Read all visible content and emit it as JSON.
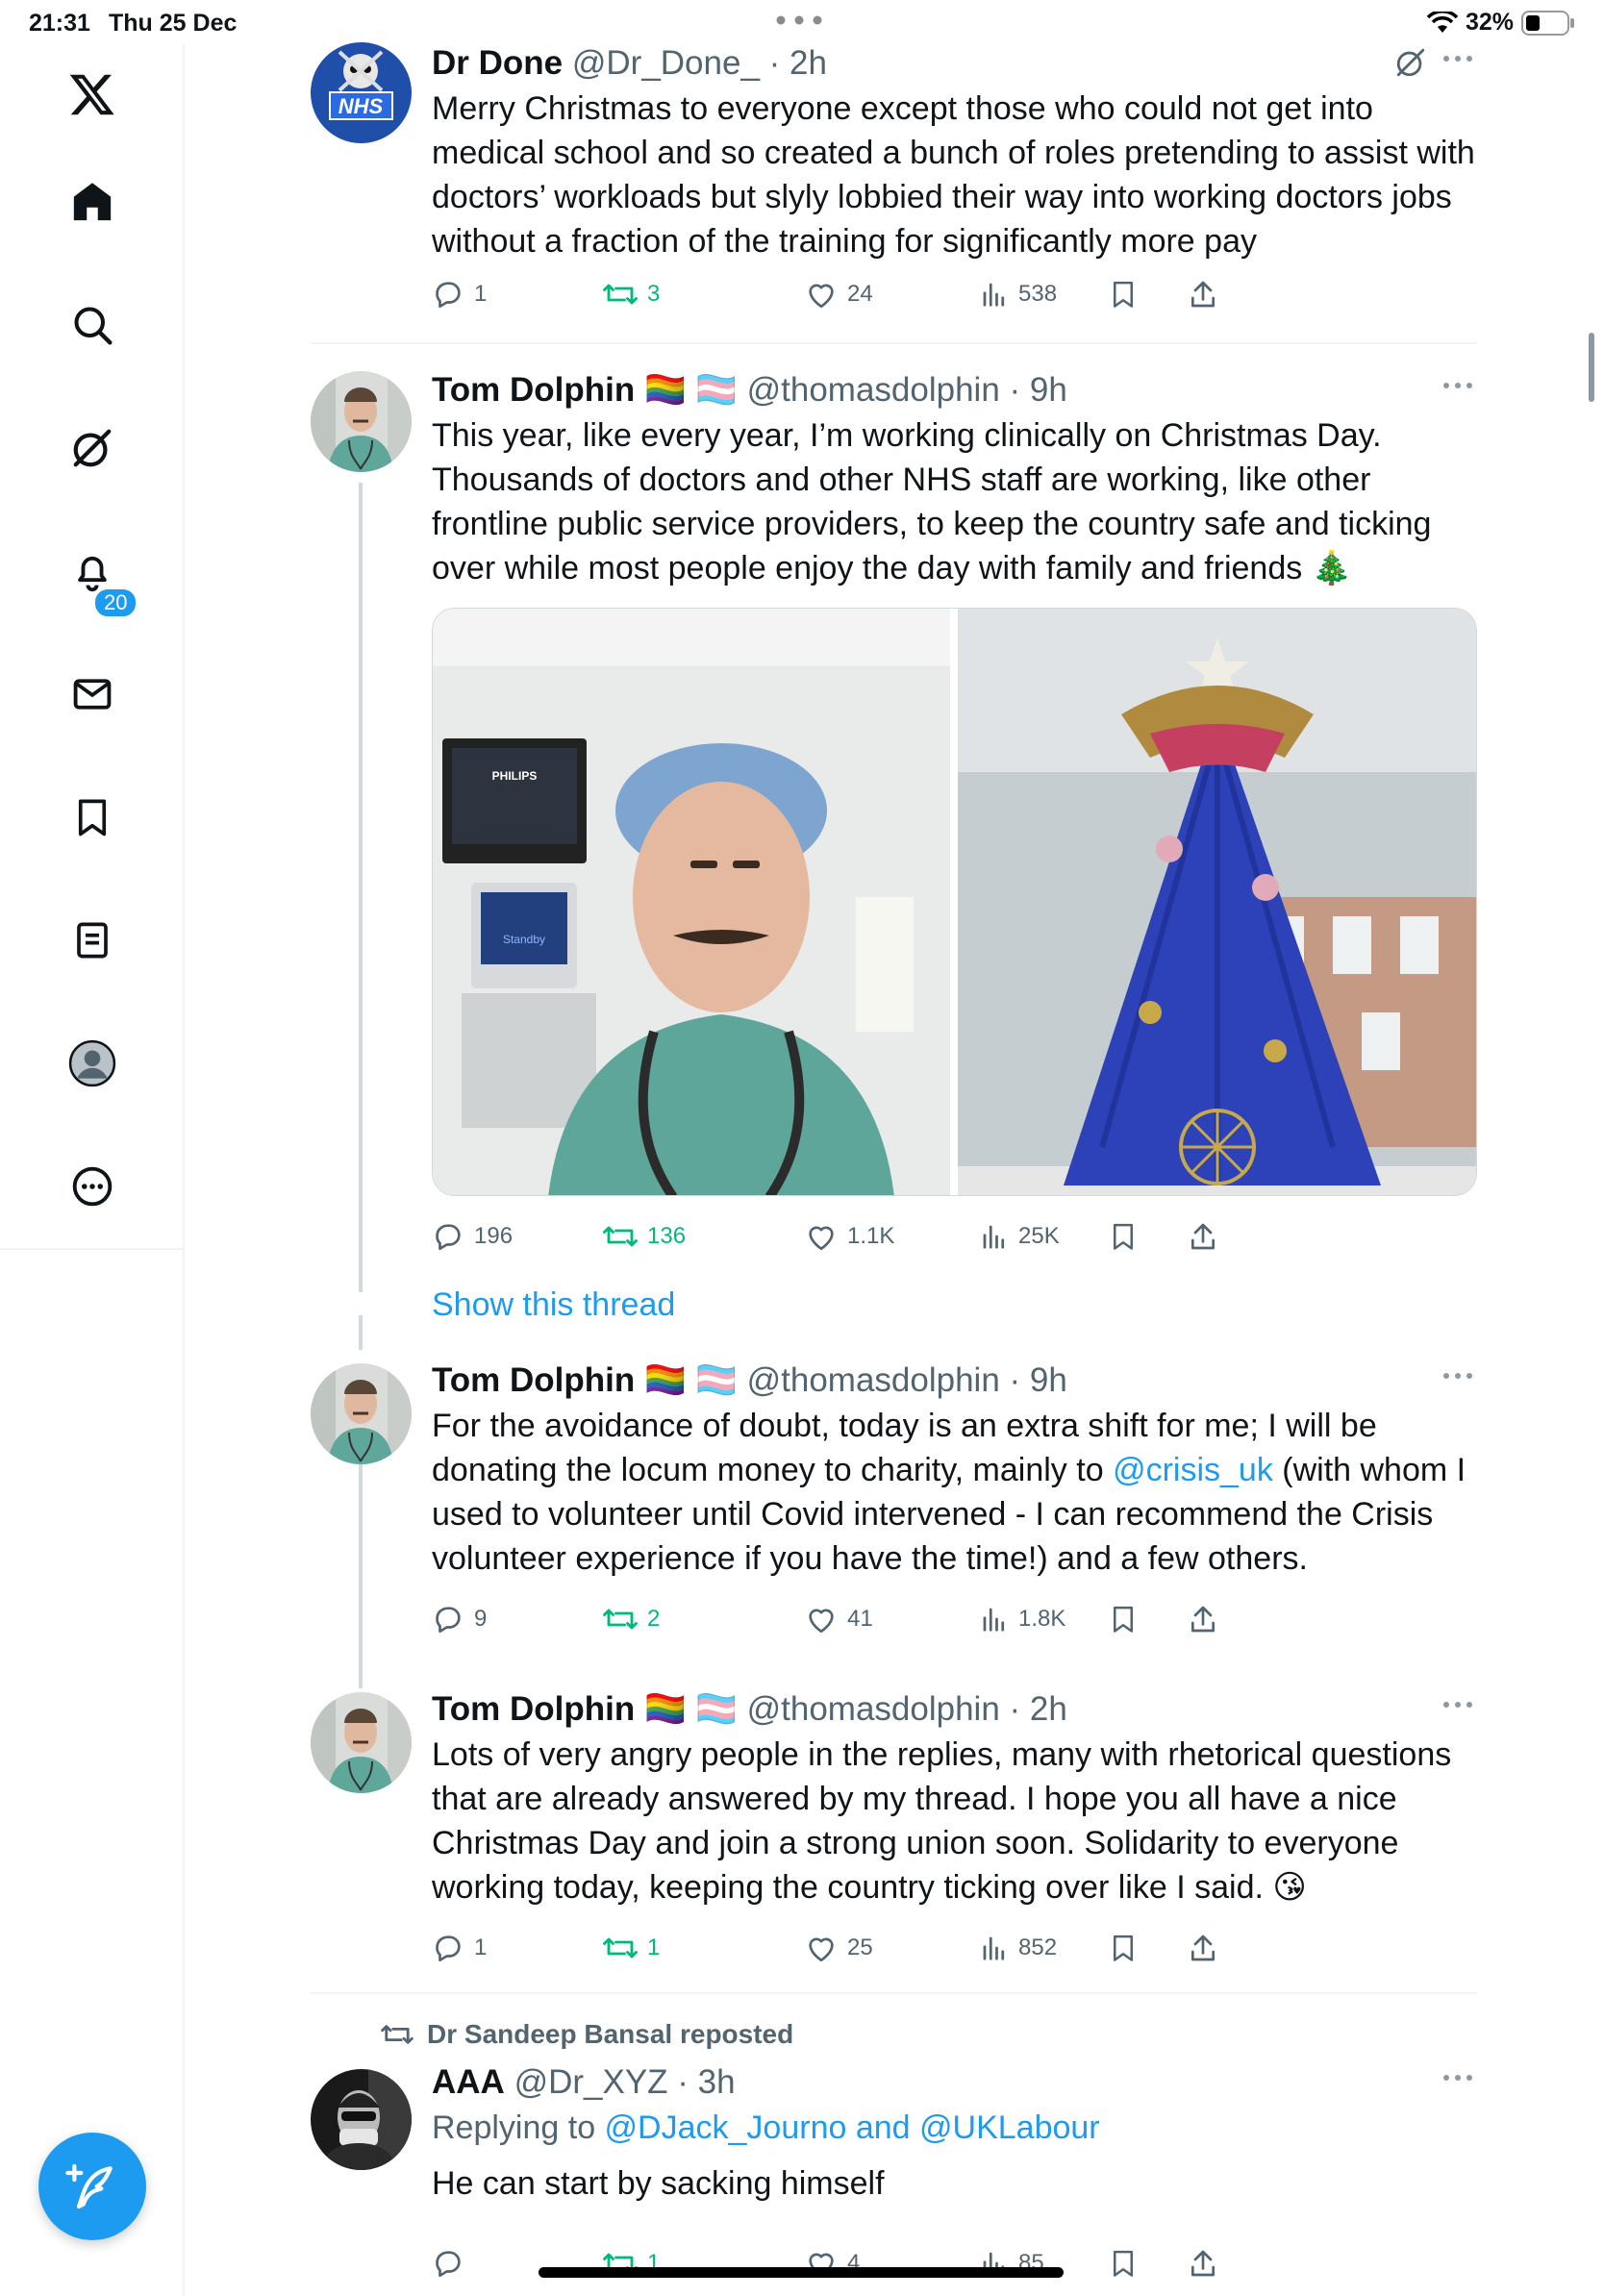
{
  "status_bar": {
    "time": "21:31",
    "date": "Thu 25 Dec",
    "battery": "32%"
  },
  "sidebar": {
    "notifications_badge": "20"
  },
  "tweets": [
    {
      "name": "Dr Done",
      "handle": "@Dr_Done_",
      "time": "· 2h",
      "text": "Merry Christmas to everyone except those who could not get into medical school and so created a bunch of roles pretending to assist with doctors’ workloads but slyly lobbied their way into working doctors jobs without a fraction of the training for significantly more pay",
      "avatar_text": "NHS",
      "replies": "1",
      "reposts": "3",
      "likes": "24",
      "views": "538"
    },
    {
      "name": "Tom Dolphin",
      "flags": "🏳️‍🌈 🏳️‍⚧️",
      "handle": "@thomasdolphin",
      "time": "· 9h",
      "text": "This year, like every year, I’m working clinically on Christmas Day. Thousands of doctors and other NHS staff are working, like other frontline public service providers, to keep the country safe and ticking over while most people enjoy the day with family and friends 🎄",
      "media_monitor_text": "PHILIPS",
      "media_standby_text": "Standby",
      "replies": "196",
      "reposts": "136",
      "likes": "1.1K",
      "views": "25K"
    },
    {
      "name": "Tom Dolphin",
      "flags": "🏳️‍🌈 🏳️‍⚧️",
      "handle": "@thomasdolphin",
      "time": "· 9h",
      "text_before": "For the avoidance of doubt, today is an extra shift for me; I will be donating the locum money to charity, mainly to ",
      "mention": "@crisis_uk",
      "text_after": " (with whom I used to volunteer until Covid intervened - I can recommend the Crisis volunteer experience if you have the time!) and a few others.",
      "replies": "9",
      "reposts": "2",
      "likes": "41",
      "views": "1.8K"
    },
    {
      "name": "Tom Dolphin",
      "flags": "🏳️‍🌈 🏳️‍⚧️",
      "handle": "@thomasdolphin",
      "time": "· 2h",
      "text": "Lots of very angry people in the replies, many with rhetorical questions that are already answered by my thread. I hope you all have a nice Christmas Day and join a strong union soon. Solidarity to everyone working today, keeping the country ticking over like I said. 😘",
      "replies": "1",
      "reposts": "1",
      "likes": "25",
      "views": "852"
    },
    {
      "reposted_by": "Dr Sandeep Bansal reposted",
      "name": "AAA",
      "handle": "@Dr_XYZ",
      "time": "· 3h",
      "replying_prefix": "Replying to ",
      "replying_to": "@DJack_Journo and @UKLabour",
      "text": "He can start by sacking himself",
      "replies": "",
      "reposts": "1",
      "likes": "4",
      "views": "85"
    }
  ],
  "show_thread": "Show this thread",
  "colors": {
    "accent": "#1d9bf0",
    "repost": "#00ba7c",
    "secondary": "#536471",
    "divider": "#eff3f4"
  }
}
